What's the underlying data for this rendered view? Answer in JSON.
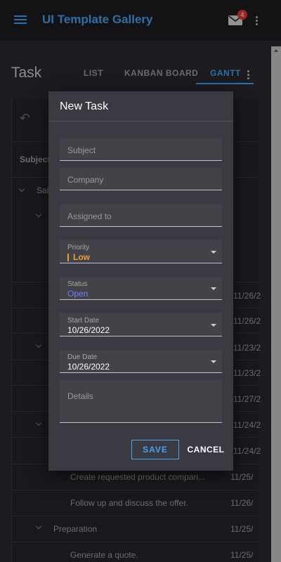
{
  "app": {
    "title": "UI Template Gallery",
    "notification_count": "4"
  },
  "page": {
    "title": "Task",
    "tabs": [
      {
        "label": "LIST",
        "active": false
      },
      {
        "label": "KANBAN BOARD",
        "active": false
      },
      {
        "label": "GANTT",
        "active": true
      }
    ]
  },
  "background": {
    "column_header": "Subject",
    "group_partial": "Sal",
    "rows": [
      {
        "subject": "Create requested product compari...",
        "date": "11/25/"
      },
      {
        "subject": "Follow up and discuss the offer.",
        "date": "11/26/"
      },
      {
        "subject": "Preparation",
        "date": "11/25/"
      },
      {
        "subject": "Generate a quote.",
        "date": "11/25/"
      }
    ],
    "partial_dates": [
      "11/26/2",
      "11/26/2",
      "11/23/2",
      "11/23/2",
      "11/27/2",
      "11/24/2",
      "11/24/2"
    ]
  },
  "dialog": {
    "title": "New Task",
    "fields": {
      "subject": {
        "placeholder": "Subject",
        "value": ""
      },
      "company": {
        "placeholder": "Company",
        "value": ""
      },
      "assigned": {
        "placeholder": "Assigned to",
        "value": ""
      },
      "priority": {
        "label": "Priority",
        "value": "Low"
      },
      "status": {
        "label": "Status",
        "value": "Open"
      },
      "start_date": {
        "label": "Start Date",
        "value": "10/26/2022"
      },
      "due_date": {
        "label": "Due Date",
        "value": "10/26/2022"
      },
      "details": {
        "placeholder": "Details",
        "value": ""
      }
    },
    "save_label": "SAVE",
    "cancel_label": "CANCEL"
  },
  "colors": {
    "accent": "#42a5f5",
    "priority_low": "#e8a13c",
    "status_open": "#6f7fff",
    "badge": "#e53935"
  }
}
